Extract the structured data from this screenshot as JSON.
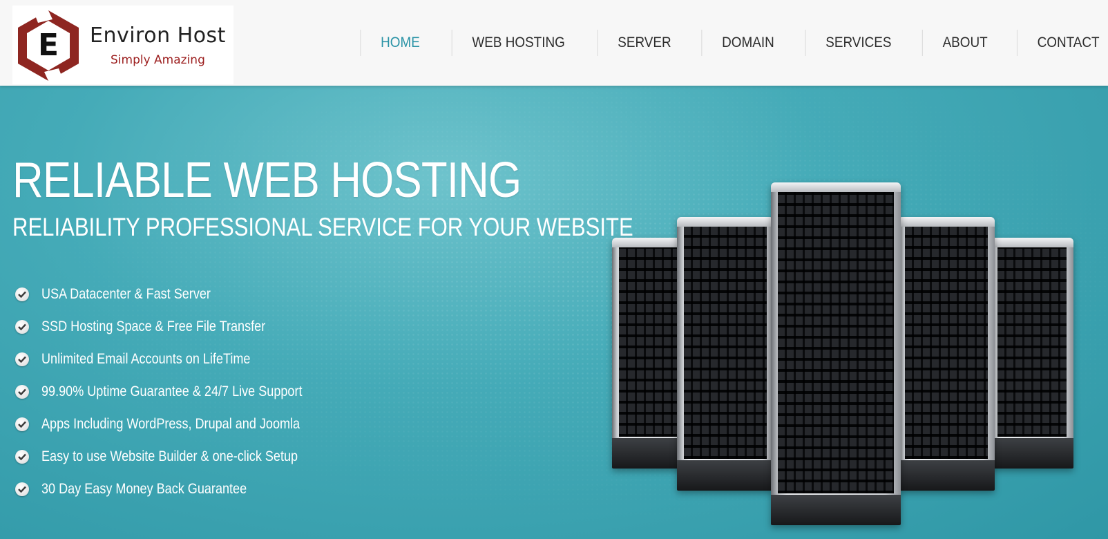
{
  "brand": {
    "name": "Environ Host",
    "tagline": "Simply Amazing",
    "logo_letter": "E",
    "logo_color": "#8e2621"
  },
  "nav": {
    "items": [
      {
        "label": "HOME",
        "active": true
      },
      {
        "label": "WEB HOSTING",
        "active": false
      },
      {
        "label": "SERVER",
        "active": false
      },
      {
        "label": "DOMAIN",
        "active": false
      },
      {
        "label": "SERVICES",
        "active": false
      },
      {
        "label": "ABOUT",
        "active": false
      },
      {
        "label": "CONTACT",
        "active": false
      }
    ],
    "active_color": "#2a93a6"
  },
  "hero": {
    "title": "RELIABLE WEB HOSTING",
    "subtitle": "RELIABILITY PROFESSIONAL SERVICE FOR YOUR WEBSITE",
    "background_color": "#45abb8",
    "features": [
      "USA Datacenter & Fast Server",
      "SSD Hosting Space & Free File Transfer",
      "Unlimited Email Accounts on LifeTime",
      "99.90% Uptime Guarantee & 24/7 Live Support",
      "Apps Including WordPress, Drupal and Joomla",
      "Easy to use Website Builder & one-click Setup",
      "30 Day Easy Money Back Guarantee"
    ],
    "feature_icon": "check-circle-icon",
    "illustration": "server-racks-icon"
  }
}
